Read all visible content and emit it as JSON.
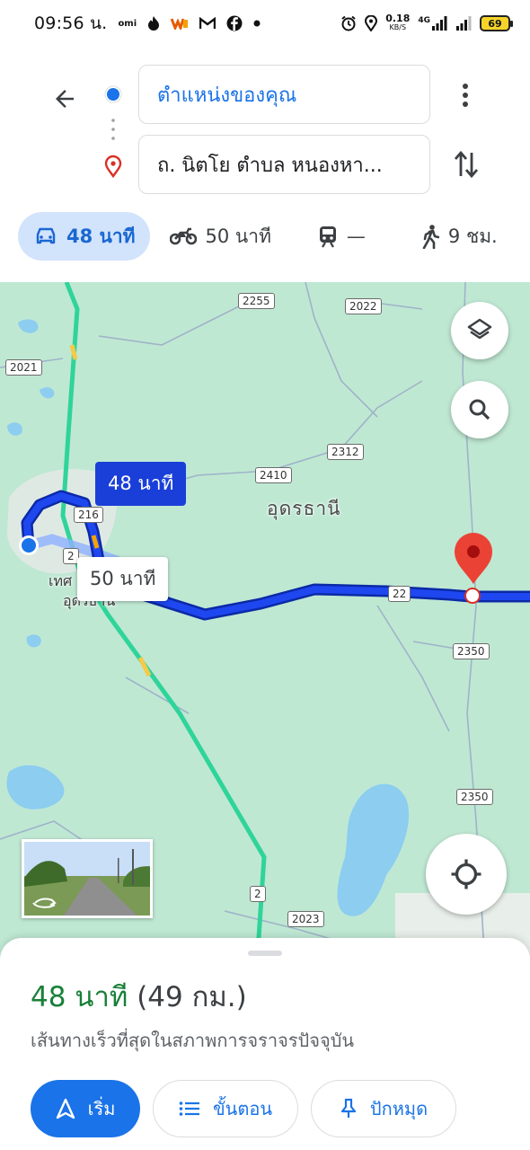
{
  "status_bar": {
    "time": "09:56 น.",
    "left_icons": [
      "omi-icon",
      "fire-icon",
      "shopee-icon",
      "gmail-icon",
      "facebook-icon",
      "dot-icon"
    ],
    "net_speed_value": "0.18",
    "net_speed_unit": "KB/S",
    "network": "4G",
    "battery": "69"
  },
  "directions": {
    "origin": "ตำแหน่งของคุณ",
    "destination": "ถ. นิตโย ตำบล หนองหา...",
    "modes": [
      {
        "name": "car",
        "label": "48 นาที",
        "active": true
      },
      {
        "name": "motorbike",
        "label": "50 นาที",
        "active": false
      },
      {
        "name": "transit",
        "label": "—",
        "active": false
      },
      {
        "name": "walk",
        "label": "9 ชม.",
        "active": false
      }
    ]
  },
  "map": {
    "road_shields": [
      "2255",
      "2022",
      "2021",
      "2312",
      "2410",
      "216",
      "2",
      "22",
      "2350",
      "2350",
      "2",
      "2023"
    ],
    "place_label": "อุดรธานี",
    "town_label_line1": "เทศ",
    "town_label_line2": "อุดรธานี",
    "route_callout_primary": "48 นาที",
    "route_callout_alt": "50 นาที",
    "colors": {
      "map_bg": "#bfe8d3",
      "route": "#1a3fd8",
      "highway": "#2fd49a",
      "water": "#8ccdf0",
      "destination_pin": "#ea4335"
    }
  },
  "sheet": {
    "duration": "48 นาที",
    "distance": "(49 กม.)",
    "subtitle": "เส้นทางเร็วที่สุดในสภาพการจราจรปัจจุบัน",
    "start_label": "เริ่ม",
    "steps_label": "ขั้นตอน",
    "pin_label": "ปักหมุด"
  }
}
